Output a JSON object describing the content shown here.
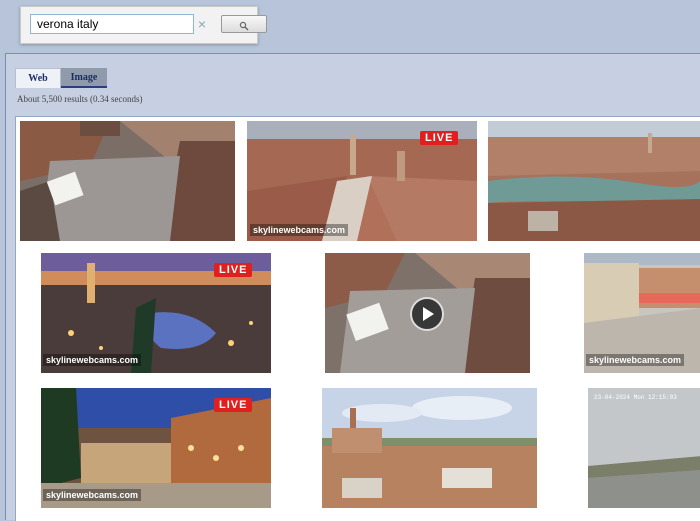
{
  "search": {
    "value": "verona italy",
    "clear_symbol": "×"
  },
  "tabs": [
    {
      "label": "Web"
    },
    {
      "label": "Image"
    }
  ],
  "stats": "About 5,500 results (0.34 seconds)",
  "results": [
    {
      "badge": "",
      "watermark": ""
    },
    {
      "badge": "LIVE",
      "watermark": "skylinewebcams.com"
    },
    {
      "badge": "",
      "watermark": ""
    },
    {
      "badge": "LIVE",
      "watermark": "skylinewebcams.com"
    },
    {
      "badge": "",
      "watermark": "",
      "video": true
    },
    {
      "badge": "",
      "watermark": "skylinewebcams.com"
    },
    {
      "badge": "LIVE",
      "watermark": "skylinewebcams.com"
    },
    {
      "badge": "",
      "watermark": ""
    },
    {
      "badge": "",
      "watermark": "",
      "timestamp": "23-04-2024 Mon 12:15:03"
    }
  ],
  "colors": {
    "background": "#b7c4d9",
    "live_badge": "#e0201e"
  }
}
